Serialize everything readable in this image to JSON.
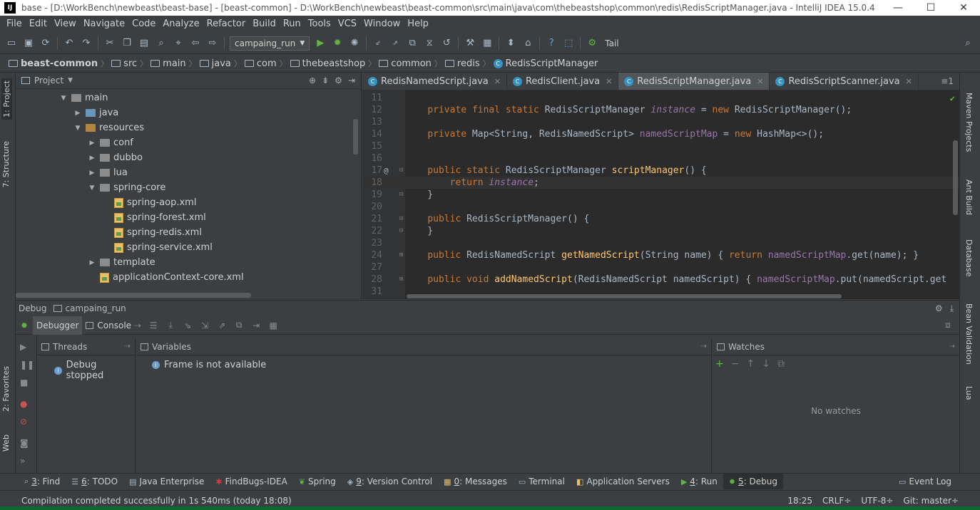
{
  "window": {
    "title": "base - [D:\\WorkBench\\newbeast\\beast-base] - [beast-common] - D:\\WorkBench\\newbeast\\beast-common\\src\\main\\java\\com\\thebeastshop\\common\\redis\\RedisScriptManager.java - IntelliJ IDEA 15.0.4",
    "app_icon": "IJ",
    "minimize": "—",
    "maximize": "☐",
    "close": "✕"
  },
  "menu": [
    "File",
    "Edit",
    "View",
    "Navigate",
    "Code",
    "Analyze",
    "Refactor",
    "Build",
    "Run",
    "Tools",
    "VCS",
    "Window",
    "Help"
  ],
  "toolbar": {
    "run_config": "campaing_run",
    "tail_label": "Tail"
  },
  "breadcrumb": {
    "module": "beast-common",
    "items": [
      "src",
      "main",
      "java",
      "com",
      "thebeastshop",
      "common",
      "redis"
    ],
    "class": "RedisScriptManager"
  },
  "left_strip": {
    "project": "1: Project",
    "structure": "7: Structure",
    "favorites": "2: Favorites",
    "web": "Web"
  },
  "right_strip": {
    "maven": "Maven Projects",
    "ant": "Ant Build",
    "database": "Database",
    "bean": "Bean Validation",
    "lua": "Lua"
  },
  "project_panel": {
    "title": "Project",
    "tree": [
      {
        "label": "main",
        "depth": 0,
        "expanded": true,
        "kind": "folder"
      },
      {
        "label": "java",
        "depth": 1,
        "expanded": false,
        "kind": "folder-src"
      },
      {
        "label": "resources",
        "depth": 1,
        "expanded": true,
        "kind": "folder-res"
      },
      {
        "label": "conf",
        "depth": 2,
        "expanded": false,
        "kind": "folder"
      },
      {
        "label": "dubbo",
        "depth": 2,
        "expanded": false,
        "kind": "folder"
      },
      {
        "label": "lua",
        "depth": 2,
        "expanded": false,
        "kind": "folder"
      },
      {
        "label": "spring-core",
        "depth": 2,
        "expanded": true,
        "kind": "folder"
      },
      {
        "label": "spring-aop.xml",
        "depth": 3,
        "kind": "xml"
      },
      {
        "label": "spring-forest.xml",
        "depth": 3,
        "kind": "xml"
      },
      {
        "label": "spring-redis.xml",
        "depth": 3,
        "kind": "xml"
      },
      {
        "label": "spring-service.xml",
        "depth": 3,
        "kind": "xml"
      },
      {
        "label": "template",
        "depth": 2,
        "expanded": false,
        "kind": "folder"
      },
      {
        "label": "applicationContext-core.xml",
        "depth": 2,
        "kind": "xml"
      }
    ]
  },
  "editor": {
    "tabs": [
      {
        "label": "RedisNamedScript.java",
        "active": false
      },
      {
        "label": "RedisClient.java",
        "active": false
      },
      {
        "label": "RedisScriptManager.java",
        "active": true
      },
      {
        "label": "RedisScriptScanner.java",
        "active": false
      }
    ],
    "tabs_overflow": "≡1",
    "lines": [
      {
        "n": "11",
        "code": ""
      },
      {
        "n": "12",
        "code": "    private final static RedisScriptManager instance = new RedisScriptManager();"
      },
      {
        "n": "13",
        "code": ""
      },
      {
        "n": "14",
        "code": "    private Map<String, RedisNamedScript> namedScriptMap = new HashMap<>();"
      },
      {
        "n": "15",
        "code": ""
      },
      {
        "n": "16",
        "code": ""
      },
      {
        "n": "17",
        "code": "    public static RedisScriptManager scriptManager() {"
      },
      {
        "n": "18",
        "code": "        return instance;"
      },
      {
        "n": "19",
        "code": "    }"
      },
      {
        "n": "20",
        "code": ""
      },
      {
        "n": "21",
        "code": "    public RedisScriptManager() {"
      },
      {
        "n": "22",
        "code": "    }"
      },
      {
        "n": "23",
        "code": ""
      },
      {
        "n": "24",
        "code": "    public RedisNamedScript getNamedScript(String name) { return namedScriptMap.get(name); }"
      },
      {
        "n": "27",
        "code": ""
      },
      {
        "n": "28",
        "code": "    public void addNamedScript(RedisNamedScript namedScript) { namedScriptMap.put(namedScript.get"
      },
      {
        "n": "31",
        "code": ""
      }
    ]
  },
  "debug": {
    "title": "Debug",
    "config": "campaing_run",
    "tabs": {
      "debugger": "Debugger",
      "console": "Console"
    },
    "threads_header": "Threads",
    "threads_msg": "Debug stopped",
    "variables_header": "Variables",
    "variables_msg": "Frame is not available",
    "watches_header": "Watches",
    "watches_msg": "No watches"
  },
  "toolwindows": [
    {
      "num": "3",
      "label": ": Find",
      "icon": "🔍"
    },
    {
      "num": "6",
      "label": ": TODO",
      "icon": "☰"
    },
    {
      "num": "",
      "label": "Java Enterprise",
      "icon": "▤"
    },
    {
      "num": "",
      "label": "FindBugs-IDEA",
      "icon": "✱"
    },
    {
      "num": "",
      "label": "Spring",
      "icon": "❦"
    },
    {
      "num": "9",
      "label": ": Version Control",
      "icon": "◈"
    },
    {
      "num": "0",
      "label": ": Messages",
      "icon": "▦"
    },
    {
      "num": "",
      "label": "Terminal",
      "icon": "▭"
    },
    {
      "num": "",
      "label": "Application Servers",
      "icon": "◧"
    },
    {
      "num": "4",
      "label": ": Run",
      "icon": "▶"
    },
    {
      "num": "5",
      "label": ": Debug",
      "icon": "✹"
    }
  ],
  "event_log": "Event Log",
  "status": {
    "message": "Compilation completed successfully in 1s 540ms (today 18:08)",
    "position": "18:25",
    "line_sep": "CRLF÷",
    "encoding": "UTF-8÷",
    "git": "Git: master÷"
  }
}
